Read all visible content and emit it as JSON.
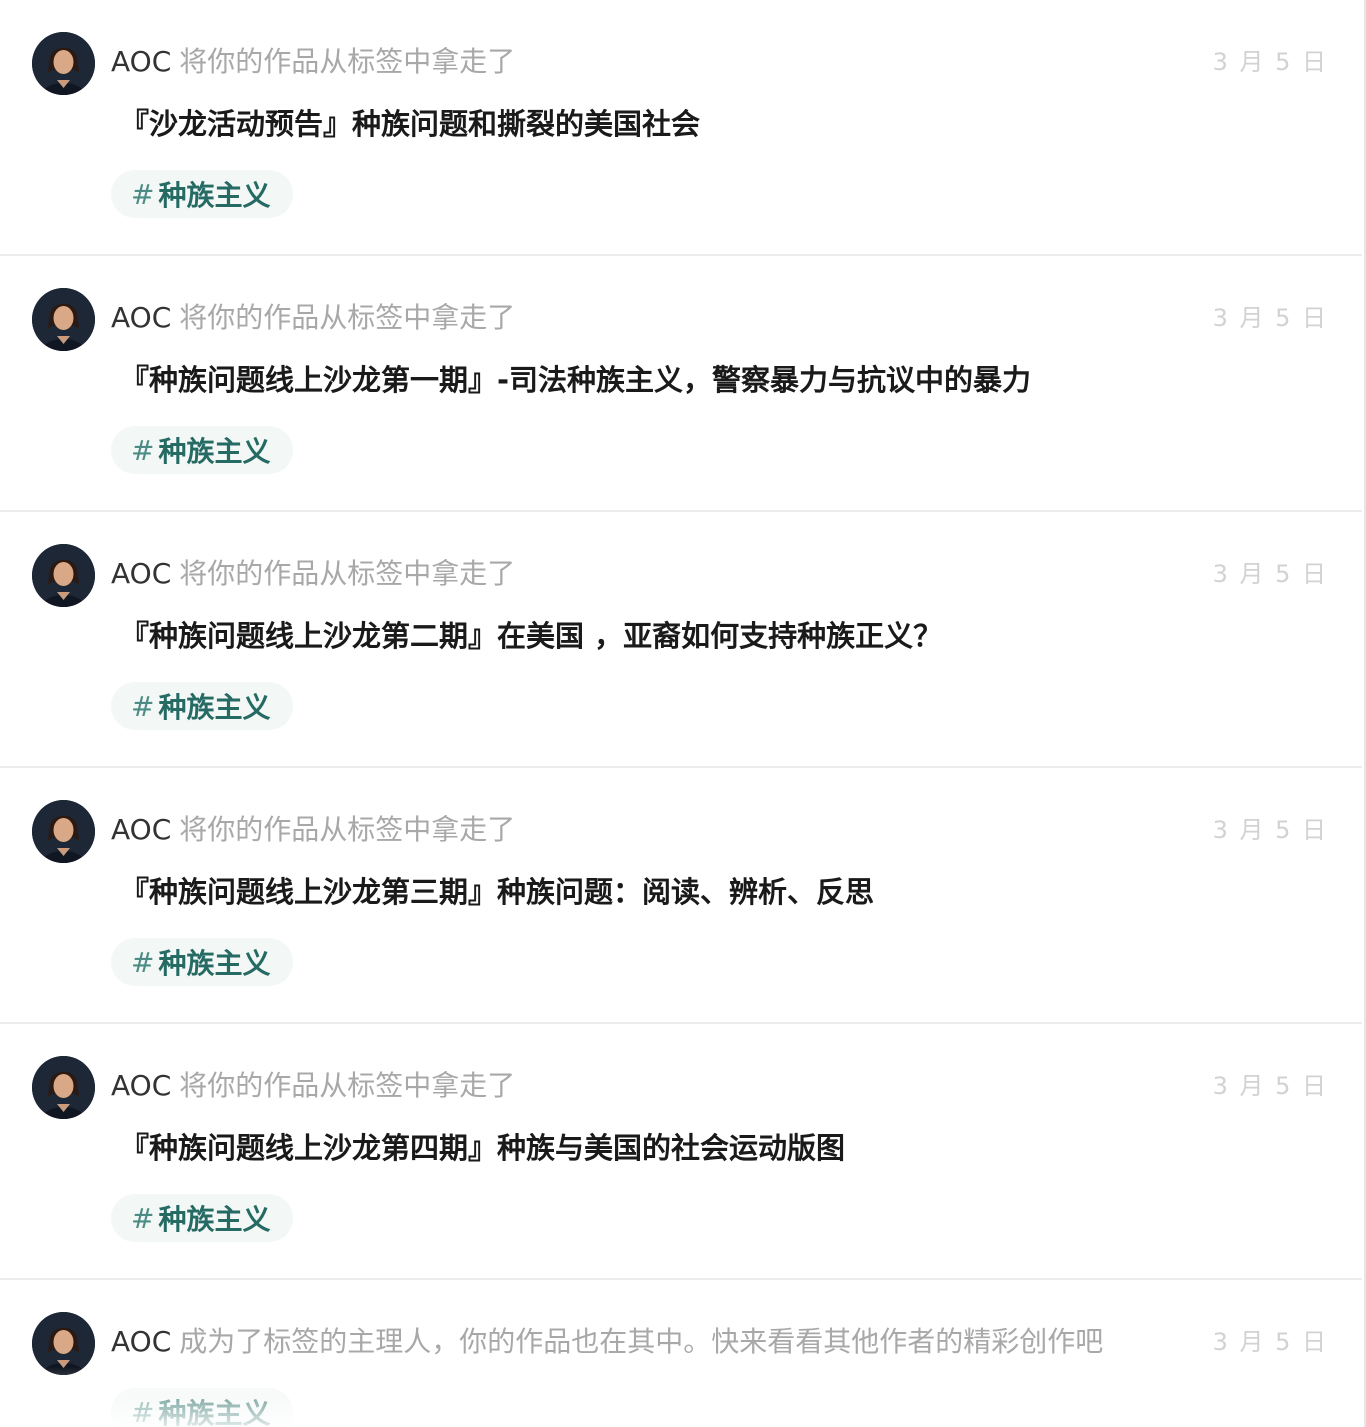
{
  "notifications": [
    {
      "user": "AOC",
      "action": "将你的作品从标签中拿走了",
      "date": "3 月 5 日",
      "title": "『沙龙活动预告』种族问题和撕裂的美国社会",
      "tag": "种族主义"
    },
    {
      "user": "AOC",
      "action": "将你的作品从标签中拿走了",
      "date": "3 月 5 日",
      "title": "『种族问题线上沙龙第一期』-司法种族主义，警察暴力与抗议中的暴力",
      "tag": "种族主义"
    },
    {
      "user": "AOC",
      "action": "将你的作品从标签中拿走了",
      "date": "3 月 5 日",
      "title": "『种族问题线上沙龙第二期』在美国 ，亚裔如何支持种族正义？",
      "tag": "种族主义"
    },
    {
      "user": "AOC",
      "action": "将你的作品从标签中拿走了",
      "date": "3 月 5 日",
      "title": "『种族问题线上沙龙第三期』种族问题：阅读、辨析、反思",
      "tag": "种族主义"
    },
    {
      "user": "AOC",
      "action": "将你的作品从标签中拿走了",
      "date": "3 月 5 日",
      "title": "『种族问题线上沙龙第四期』种族与美国的社会运动版图",
      "tag": "种族主义"
    },
    {
      "user": "AOC",
      "action": "成为了标签的主理人，你的作品也在其中。快来看看其他作者的精彩创作吧",
      "date": "3 月 5 日",
      "title": "",
      "tag": "种族主义"
    }
  ],
  "tag_prefix": "#",
  "colors": {
    "tag_bg": "#f3f7f6",
    "tag_text": "#256b63",
    "muted": "#a8a8a8",
    "date": "#d2d2d2"
  },
  "icons": {
    "avatar": "avatar-user-photo"
  }
}
